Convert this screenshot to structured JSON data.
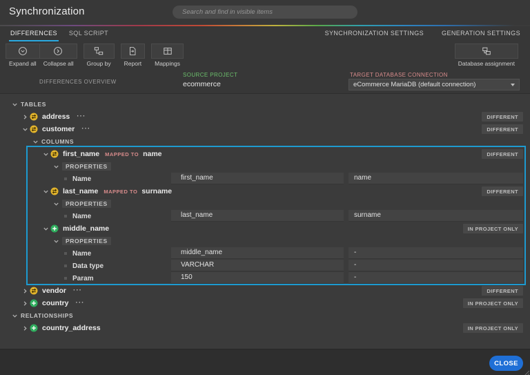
{
  "colors": {
    "accent_blue": "#2aa9e0",
    "highlight_border": "#1d9ad0",
    "close_button": "#1f6fd6",
    "icon_yellow": "#e2b42c",
    "icon_green": "#2fae5e",
    "source_label_green": "#6cbf6c",
    "target_label_pink": "#d98c8c"
  },
  "header": {
    "title": "Synchronization",
    "search_placeholder": "Search and find in visible items"
  },
  "tabs": {
    "left": [
      {
        "label": "DIFFERENCES",
        "active": true
      },
      {
        "label": "SQL SCRIPT",
        "active": false
      }
    ],
    "right": [
      {
        "label": "SYNCHRONIZATION SETTINGS"
      },
      {
        "label": "GENERATION SETTINGS"
      }
    ]
  },
  "toolbar": {
    "left_groups": [
      {
        "buttons": [
          {
            "icon": "expand-all-icon",
            "label": "Expand all"
          },
          {
            "icon": "collapse-all-icon",
            "label": "Collapse all"
          }
        ]
      },
      {
        "buttons": [
          {
            "icon": "group-by-icon",
            "label": "Group by"
          }
        ]
      },
      {
        "buttons": [
          {
            "icon": "report-icon",
            "label": "Report"
          }
        ]
      },
      {
        "buttons": [
          {
            "icon": "mappings-icon",
            "label": "Mappings"
          }
        ]
      }
    ],
    "right_groups": [
      {
        "buttons": [
          {
            "icon": "database-assignment-icon",
            "label": "Database assignment"
          }
        ]
      }
    ]
  },
  "overview": {
    "label": "DIFFERENCES OVERVIEW",
    "source": {
      "label": "SOURCE PROJECT",
      "value": "ecommerce"
    },
    "target": {
      "label": "TARGET DATABASE CONNECTION",
      "value": "eCommerce MariaDB (default connection)"
    }
  },
  "tree": {
    "rows": [
      {
        "type": "section",
        "level": 0,
        "expanded": true,
        "label": "TABLES"
      },
      {
        "type": "node",
        "level": 1,
        "expanded": false,
        "icon": "different",
        "label": "address",
        "more": "···",
        "badge": "DIFFERENT"
      },
      {
        "type": "node",
        "level": 1,
        "expanded": true,
        "icon": "different",
        "label": "customer",
        "more": "···",
        "badge": "DIFFERENT"
      },
      {
        "type": "section",
        "level": 2,
        "expanded": true,
        "label": "COLUMNS"
      },
      {
        "type": "node",
        "level": 3,
        "expanded": true,
        "icon": "different",
        "label": "first_name",
        "mapped_label": "MAPPED TO",
        "mapped_to": "name",
        "badge": "DIFFERENT",
        "highlight": true
      },
      {
        "type": "section",
        "level": 4,
        "expanded": true,
        "label": "PROPERTIES",
        "chip": true,
        "highlight": true
      },
      {
        "type": "prop",
        "level": 5,
        "label": "Name",
        "source": "first_name",
        "target": "name",
        "highlight": true
      },
      {
        "type": "node",
        "level": 3,
        "expanded": true,
        "icon": "different",
        "label": "last_name",
        "mapped_label": "MAPPED TO",
        "mapped_to": "surname",
        "badge": "DIFFERENT",
        "highlight": true
      },
      {
        "type": "section",
        "level": 4,
        "expanded": true,
        "label": "PROPERTIES",
        "chip": true,
        "highlight": true
      },
      {
        "type": "prop",
        "level": 5,
        "label": "Name",
        "source": "last_name",
        "target": "surname",
        "highlight": true
      },
      {
        "type": "node",
        "level": 3,
        "expanded": true,
        "icon": "new",
        "label": "middle_name",
        "badge": "IN PROJECT ONLY",
        "highlight": true
      },
      {
        "type": "section",
        "level": 4,
        "expanded": true,
        "label": "PROPERTIES",
        "chip": true,
        "highlight": true
      },
      {
        "type": "prop",
        "level": 5,
        "label": "Name",
        "source": "middle_name",
        "target": "-",
        "highlight": true
      },
      {
        "type": "prop",
        "level": 5,
        "label": "Data type",
        "source": "VARCHAR",
        "target": "-",
        "highlight": true
      },
      {
        "type": "prop",
        "level": 5,
        "label": "Param",
        "source": "150",
        "target": "-",
        "highlight": true
      },
      {
        "type": "node",
        "level": 1,
        "expanded": false,
        "icon": "different",
        "label": "vendor",
        "more": "···",
        "badge": "DIFFERENT"
      },
      {
        "type": "node",
        "level": 1,
        "expanded": false,
        "icon": "new",
        "label": "country",
        "more": "···",
        "badge": "IN PROJECT ONLY"
      },
      {
        "type": "section",
        "level": 0,
        "expanded": true,
        "label": "RELATIONSHIPS"
      },
      {
        "type": "node",
        "level": 1,
        "expanded": false,
        "icon": "new",
        "label": "country_address",
        "badge": "IN PROJECT ONLY"
      }
    ]
  },
  "footer": {
    "close_label": "CLOSE"
  }
}
